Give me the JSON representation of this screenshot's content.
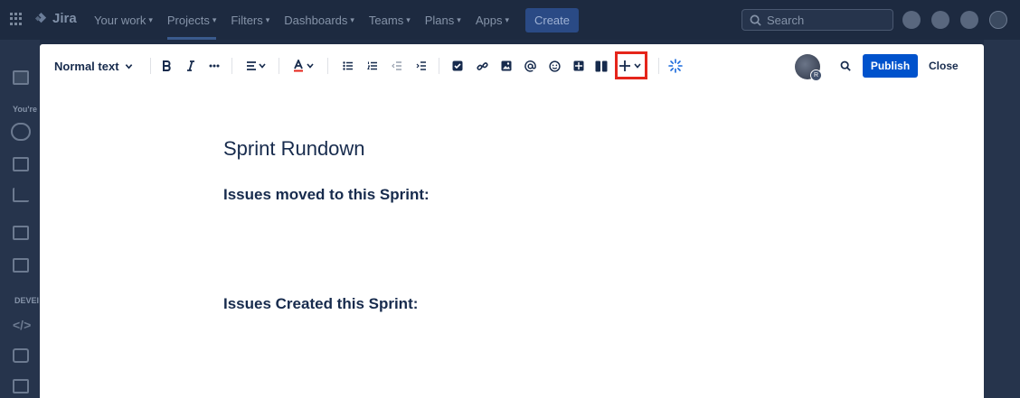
{
  "topnav": {
    "logo_text": "Jira",
    "items": [
      {
        "label": "Your work",
        "active": false
      },
      {
        "label": "Projects",
        "active": true
      },
      {
        "label": "Filters",
        "active": false
      },
      {
        "label": "Dashboards",
        "active": false
      },
      {
        "label": "Teams",
        "active": false
      },
      {
        "label": "Plans",
        "active": false
      },
      {
        "label": "Apps",
        "active": false
      }
    ],
    "create_label": "Create",
    "search_placeholder": "Search",
    "icons": [
      "apps-grid-icon",
      "notifications-icon",
      "help-icon",
      "settings-icon",
      "avatar"
    ]
  },
  "sidebar": {
    "partial_text_1": "You're",
    "section_label": "DEVEI"
  },
  "editor": {
    "text_style": "Normal text",
    "toolbar_icons": [
      "bold-icon",
      "italic-icon",
      "more-formatting-icon",
      "alignment-icon",
      "text-color-icon",
      "bullet-list-icon",
      "numbered-list-icon",
      "outdent-icon",
      "indent-icon",
      "action-item-icon",
      "link-icon",
      "image-icon",
      "mention-icon",
      "emoji-icon",
      "table-icon",
      "layouts-icon",
      "insert-plus-icon",
      "ai-sparkle-icon",
      "find-icon"
    ],
    "publish_label": "Publish",
    "close_label": "Close",
    "avatar_badge": "R",
    "accent_color": "#0052cc",
    "highlight_color": "#e5251b"
  },
  "document": {
    "title": "Sprint Rundown",
    "heading_1": "Issues moved to this Sprint:",
    "heading_2": "Issues Created this Sprint:"
  }
}
